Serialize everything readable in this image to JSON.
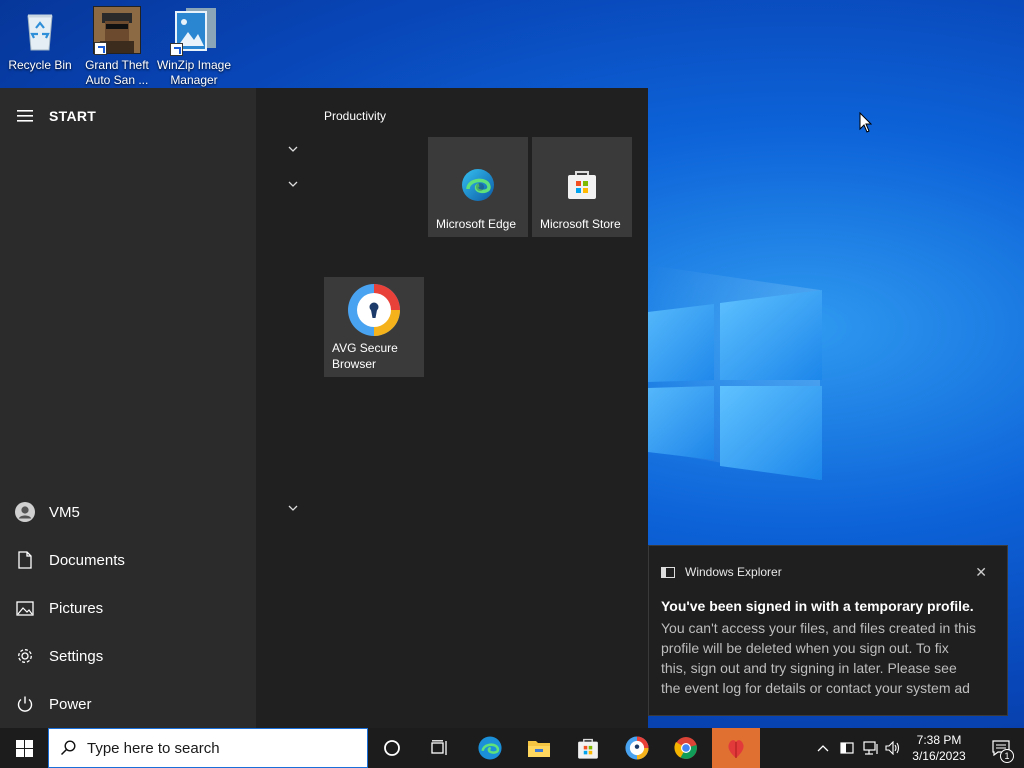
{
  "desktop": {
    "icons": [
      {
        "label": "Recycle Bin",
        "icon": "recycle-bin-icon"
      },
      {
        "label": "Grand Theft Auto San ...",
        "icon": "gta-san-andreas-icon"
      },
      {
        "label": "WinZip Image Manager",
        "icon": "winzip-image-manager-icon"
      }
    ]
  },
  "start_menu": {
    "title": "START",
    "user": "VM5",
    "nav": {
      "documents": "Documents",
      "pictures": "Pictures",
      "settings": "Settings",
      "power": "Power"
    },
    "group_title": "Productivity",
    "tiles": [
      {
        "label": "Microsoft Edge",
        "icon": "edge-icon"
      },
      {
        "label": "Microsoft Store",
        "icon": "store-icon"
      },
      {
        "label": "AVG Secure Browser",
        "icon": "avg-browser-icon"
      }
    ]
  },
  "notification": {
    "app": "Windows Explorer",
    "title": "You've been signed in with a temporary profile.",
    "body_lines": [
      "You can't access your files, and files created in this",
      "profile will be deleted when you sign out. To fix",
      "this, sign out and try signing in later.  Please see",
      "the event log for details or contact your system ad"
    ]
  },
  "taskbar": {
    "search_placeholder": "Type here to search",
    "time": "7:38 PM",
    "date": "3/16/2023",
    "notification_count": "1",
    "accent": "#e07032"
  }
}
